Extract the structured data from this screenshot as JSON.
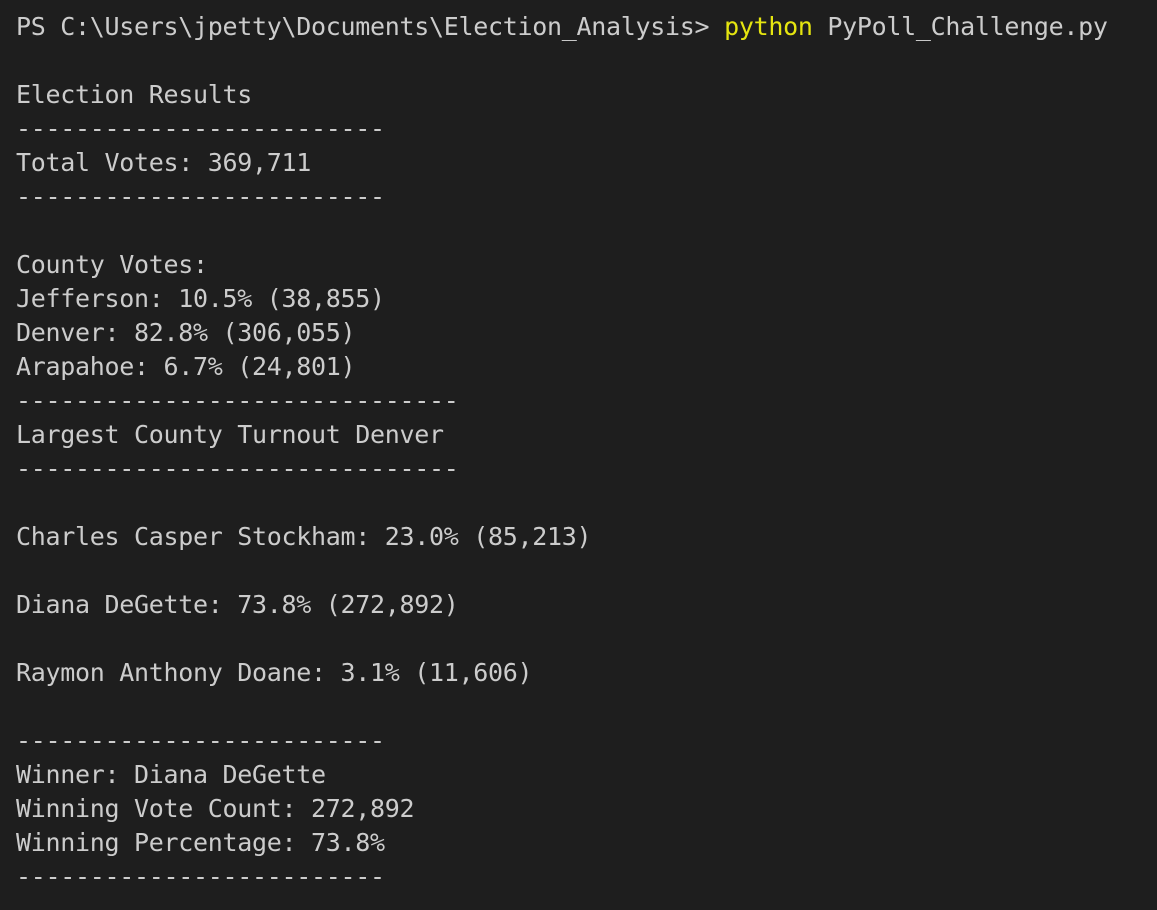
{
  "terminal": {
    "prompt": "PS C:\\Users\\jpetty\\Documents\\Election_Analysis> ",
    "command_name": "python",
    "command_args": " PyPoll_Challenge.py",
    "highlight_color": "#e5e510",
    "lines": [
      "",
      "Election Results",
      "-------------------------",
      "Total Votes: 369,711",
      "-------------------------",
      "",
      "County Votes:",
      "Jefferson: 10.5% (38,855)",
      "Denver: 82.8% (306,055)",
      "Arapahoe: 6.7% (24,801)",
      "------------------------------",
      "Largest County Turnout Denver",
      "------------------------------",
      "",
      "Charles Casper Stockham: 23.0% (85,213)",
      "",
      "Diana DeGette: 73.8% (272,892)",
      "",
      "Raymon Anthony Doane: 3.1% (11,606)",
      "",
      "-------------------------",
      "Winner: Diana DeGette",
      "Winning Vote Count: 272,892",
      "Winning Percentage: 73.8%",
      "-------------------------"
    ]
  }
}
